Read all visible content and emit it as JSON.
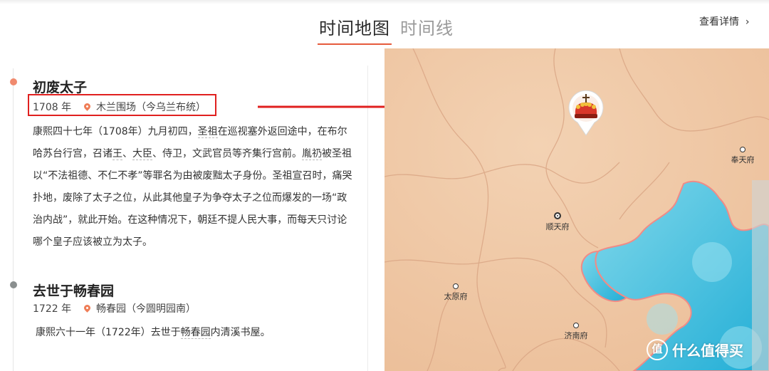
{
  "tabs": {
    "map_label": "时间地图",
    "timeline_label": "时间线",
    "active": "map"
  },
  "detail_link": "查看详情",
  "events": [
    {
      "title": "初废太子",
      "year": "1708 年",
      "place": "木兰围场（今乌兰布统）",
      "desc_parts": [
        "康熙四十七年（1708年）九月初四，",
        "圣祖",
        "在巡视塞外返回途中，在布尔哈苏台行宫，召诸",
        "王",
        "、",
        "大臣",
        "、侍卫，文武官员等齐集行宫前。",
        "胤礽",
        "被圣祖以“不法祖德、不仁不孝”等罪名为由被废黜太子身份。圣祖宣召时，痛哭扑地，废除了太子之位，从此其他皇子为争夺太子之位而爆发的一场“政治内战”，就此开始。在这种情况下，朝廷不提人民大事，而每天只讨论哪个皇子应该被立为太子。"
      ]
    },
    {
      "title": "去世于畅春园",
      "year": "1722 年",
      "place": "畅春园（今圆明园南）",
      "desc_parts": [
        "康熙六十一年（1722年）去世于",
        "畅春园",
        "内清溪书屋。"
      ]
    }
  ],
  "map": {
    "cities": {
      "fengtian": "奉天府",
      "shuntian": "顺天府",
      "taiyuan": "太原府",
      "jinan": "济南府"
    },
    "marker": "crown-icon",
    "colors": {
      "land": "#f1c8a4",
      "sea": "#3fc1dd",
      "border": "#d9a483",
      "coast": "#f08b86"
    }
  },
  "annotation": {
    "box_color": "#e0201f",
    "arrow_color": "#e0201f"
  },
  "watermark": {
    "logo": "值",
    "text": "什么值得买"
  },
  "colors": {
    "accent": "#e65a3c",
    "pin": "#ef7d56"
  }
}
